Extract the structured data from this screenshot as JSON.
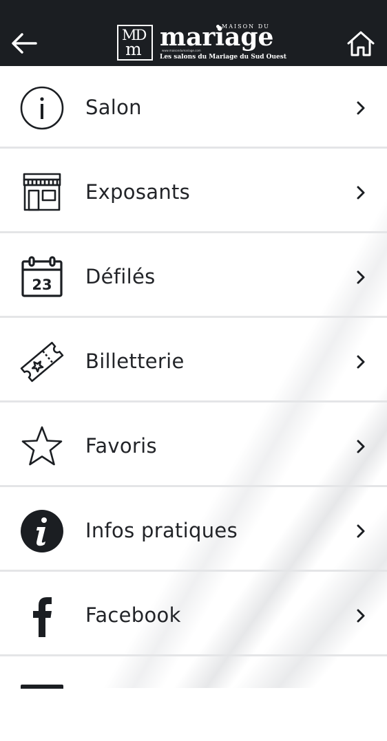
{
  "header": {
    "logo": {
      "monogram_top": "MD",
      "monogram_bottom": "m",
      "brand_small": "MAISON DU",
      "brand_word": "mariage",
      "url": "www.maisondumariage.com",
      "tagline": "Les salons du Mariage du Sud Ouest"
    },
    "background_color": "#1b1e22"
  },
  "menu": {
    "items": [
      {
        "label": "Salon",
        "icon": "info-circle-icon"
      },
      {
        "label": "Exposants",
        "icon": "storefront-icon"
      },
      {
        "label": "Défilés",
        "icon": "calendar-icon",
        "icon_text": "23"
      },
      {
        "label": "Billetterie",
        "icon": "ticket-icon"
      },
      {
        "label": "Favoris",
        "icon": "star-icon"
      },
      {
        "label": "Infos pratiques",
        "icon": "info-filled-icon"
      },
      {
        "label": "Facebook",
        "icon": "facebook-icon"
      }
    ]
  }
}
